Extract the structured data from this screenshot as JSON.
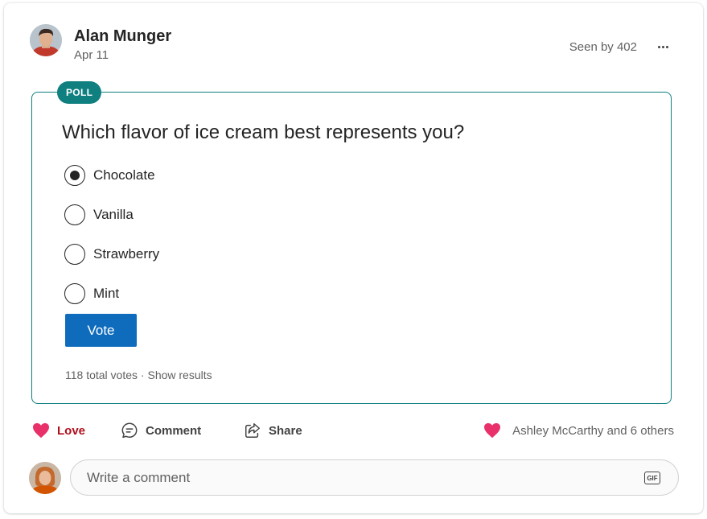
{
  "post": {
    "author": "Alan Munger",
    "date": "Apr 11",
    "seen_by": "Seen by 402"
  },
  "poll": {
    "badge": "POLL",
    "question": "Which flavor of ice cream best represents you?",
    "options": [
      {
        "label": "Chocolate",
        "selected": true
      },
      {
        "label": "Vanilla",
        "selected": false
      },
      {
        "label": "Strawberry",
        "selected": false
      },
      {
        "label": "Mint",
        "selected": false
      }
    ],
    "vote_label": "Vote",
    "total_votes": "118 total votes",
    "separator": "·",
    "show_results": "Show results"
  },
  "actions": {
    "love": "Love",
    "comment": "Comment",
    "share": "Share",
    "reactions_text": "Ashley McCarthy and 6 others"
  },
  "comment": {
    "placeholder": "Write a comment",
    "gif_label": "GIF"
  },
  "colors": {
    "accent_teal": "#0f7f80",
    "vote_blue": "#0f6cbd",
    "love_red": "#b10e1c",
    "heart_pink": "#e8306a"
  }
}
